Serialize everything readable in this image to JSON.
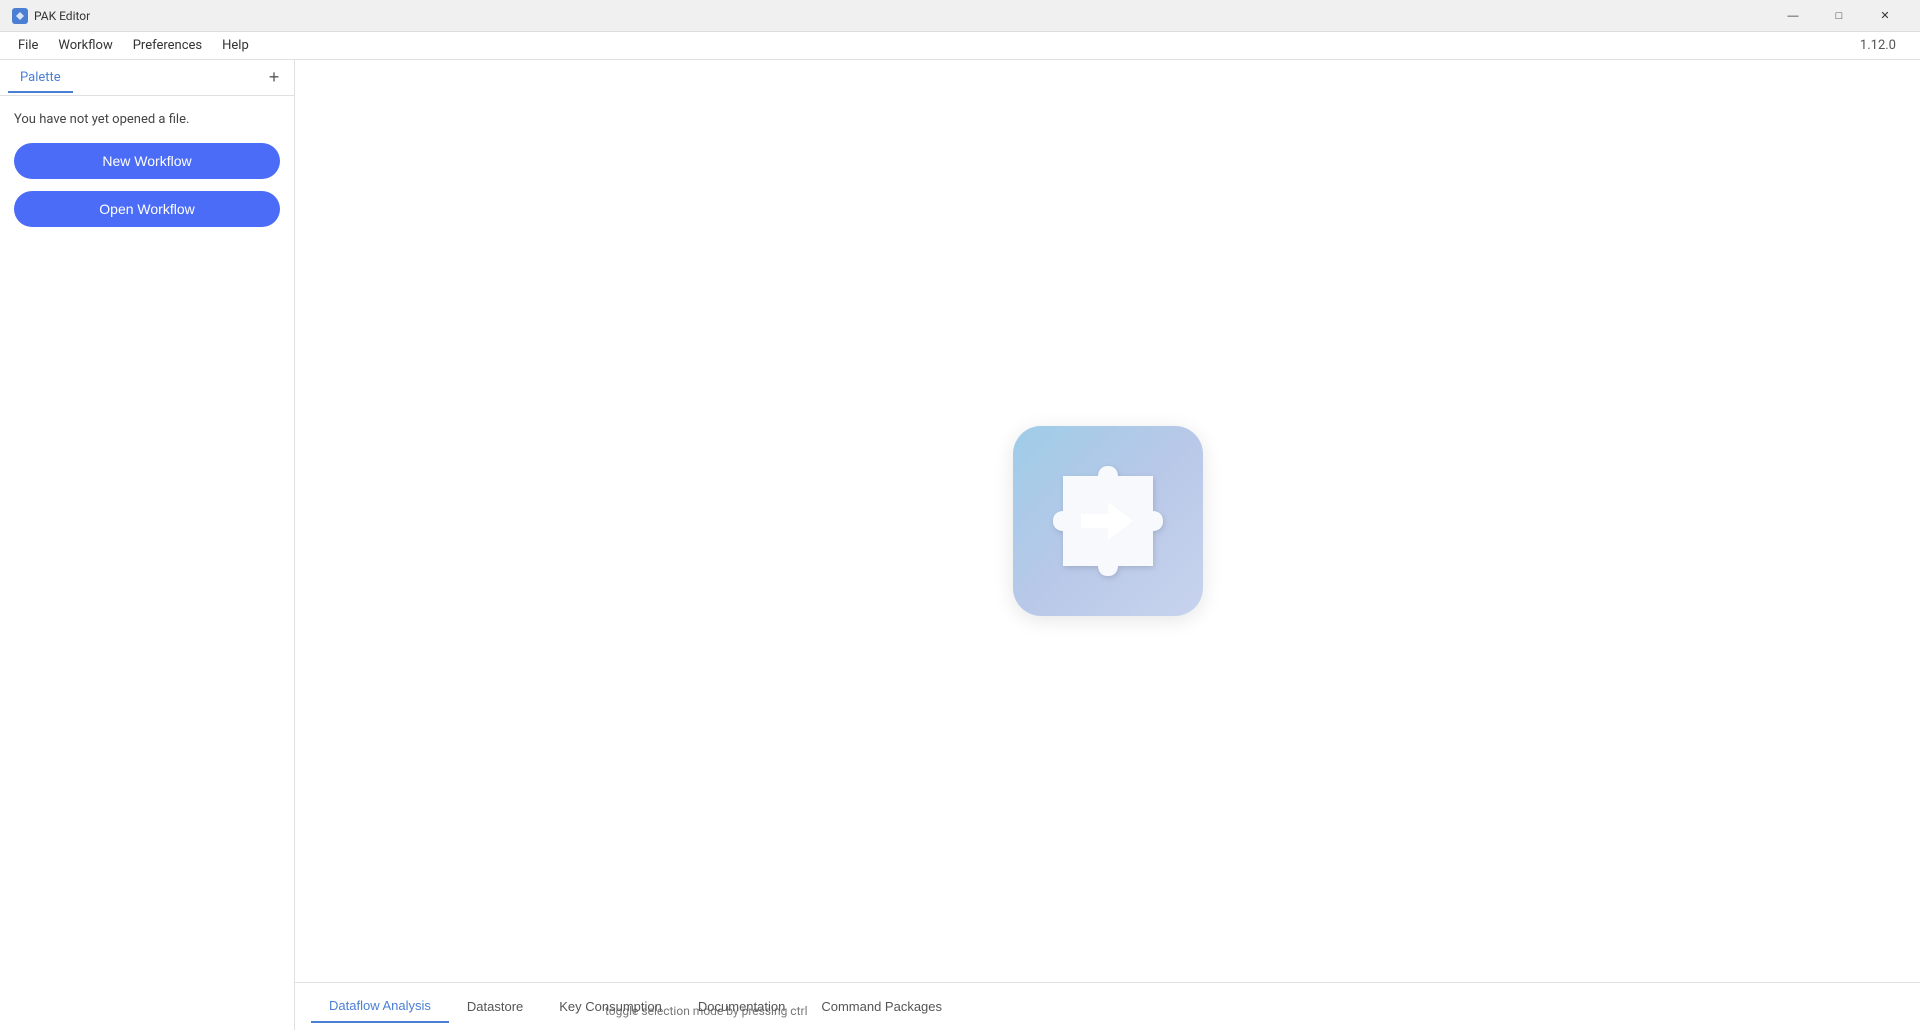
{
  "titleBar": {
    "appName": "PAK Editor",
    "minimize": "—",
    "maximize": "□",
    "close": "✕"
  },
  "menuBar": {
    "items": [
      "File",
      "Workflow",
      "Preferences",
      "Help"
    ],
    "version": "1.12.0"
  },
  "sidebar": {
    "tabLabel": "Palette",
    "addButton": "+",
    "noFileText": "You have not yet opened a file.",
    "newWorkflowLabel": "New Workflow",
    "openWorkflowLabel": "Open Workflow"
  },
  "canvas": {
    "toggleHint": "toggle selection mode by pressing ctrl"
  },
  "bottomTabs": [
    {
      "id": "dataflow-analysis",
      "label": "Dataflow Analysis",
      "active": true
    },
    {
      "id": "datastore",
      "label": "Datastore",
      "active": false
    },
    {
      "id": "key-consumption",
      "label": "Key Consumption",
      "active": false
    },
    {
      "id": "documentation",
      "label": "Documentation",
      "active": false
    },
    {
      "id": "command-packages",
      "label": "Command Packages",
      "active": false
    }
  ]
}
